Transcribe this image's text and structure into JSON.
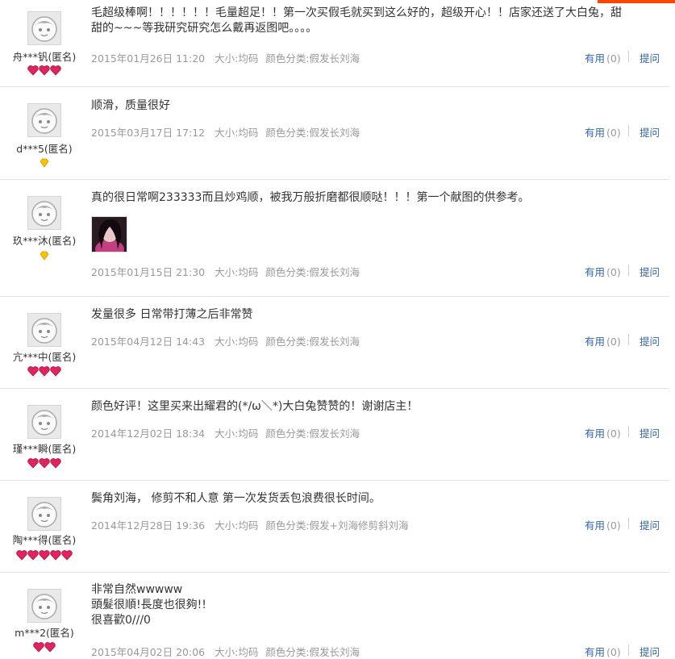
{
  "labels": {
    "useful": "有用",
    "ask": "提问"
  },
  "reviews": [
    {
      "username": "舟***钒(匿名)",
      "badge": "heart-3",
      "text": "毛超级棒啊！！！！！！毛量超足！！第一次买假毛就买到这么好的，超级开心！！店家还送了大白兔，甜\n甜的~~~等我研究研究怎么戴再返图吧。。。。",
      "date": "2015年01月26日 11:20",
      "size": "大小:均码",
      "color": "颜色分类:假发长刘海",
      "useful_count": "(0)"
    },
    {
      "username": "d***5(匿名)",
      "badge": "diamond-1",
      "text": "顺滑，质量很好",
      "date": "2015年03月17日 17:12",
      "size": "大小:均码",
      "color": "颜色分类:假发长刘海",
      "useful_count": "(0)"
    },
    {
      "username": "玖***沐(匿名)",
      "badge": "diamond-1",
      "text": "真的很日常啊233333而且炒鸡顺，被我万般折磨都很顺哒！！！第一个献图的供参考。",
      "date": "2015年01月15日 21:30",
      "size": "大小:均码",
      "color": "颜色分类:假发长刘海",
      "useful_count": "(0)"
    },
    {
      "username": "亢***中(匿名)",
      "badge": "heart-3",
      "text": "发量很多 日常带打薄之后非常赞",
      "date": "2015年04月12日 14:43",
      "size": "大小:均码",
      "color": "颜色分类:假发长刘海",
      "useful_count": "(0)"
    },
    {
      "username": "瑾***瞬(匿名)",
      "badge": "heart-3",
      "text": "颜色好评！这里买来出耀君的(*/ω＼*)大白兔赞赞的！谢谢店主！",
      "date": "2014年12月02日 18:34",
      "size": "大小:均码",
      "color": "颜色分类:假发长刘海",
      "useful_count": "(0)"
    },
    {
      "username": "陶***得(匿名)",
      "badge": "heart-5",
      "text": "鬓角刘海， 修剪不和人意 第一次发货丢包浪费很长时间。",
      "date": "2014年12月28日 19:36",
      "size": "大小:均码",
      "color": "颜色分类:假发+刘海修剪斜刘海",
      "useful_count": "(0)"
    },
    {
      "username": "m***2(匿名)",
      "badge": "heart-2",
      "text": "非常自然wwwww\n頭髮很順!長度也很夠!!\n很喜歡0///0",
      "date": "2015年04月02日 20:06",
      "size": "大小:均码",
      "color": "颜色分类:假发长刘海",
      "useful_count": "(0)"
    }
  ]
}
